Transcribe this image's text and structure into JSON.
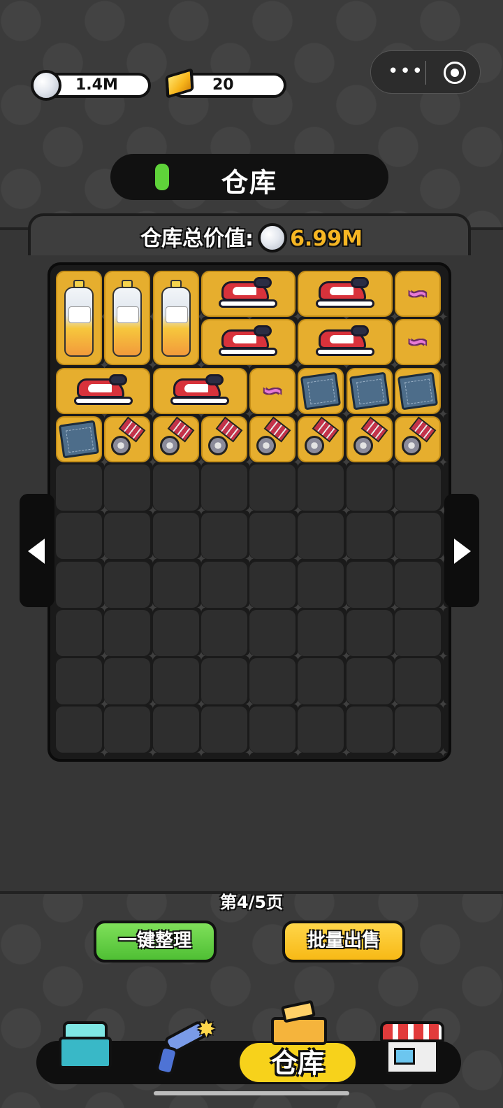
{
  "currency": {
    "silver": "1.4M",
    "gold": "20"
  },
  "capsule": {
    "more_icon": "more-dots-icon",
    "close_icon": "target-icon"
  },
  "header": {
    "title": "仓库"
  },
  "warehouse": {
    "total_label": "仓库总价值:",
    "total_value": "6.99M",
    "grid": {
      "columns": 8,
      "rows": 10,
      "items": [
        {
          "type": "bottle",
          "icon": "bottle-icon",
          "col": 0,
          "row": 0,
          "w": 1,
          "h": 2
        },
        {
          "type": "bottle",
          "icon": "bottle-icon",
          "col": 1,
          "row": 0,
          "w": 1,
          "h": 2
        },
        {
          "type": "bottle",
          "icon": "bottle-icon",
          "col": 2,
          "row": 0,
          "w": 1,
          "h": 2
        },
        {
          "type": "shoe",
          "icon": "sneaker-icon",
          "col": 3,
          "row": 0,
          "w": 2,
          "h": 1
        },
        {
          "type": "shoe",
          "icon": "sneaker-icon",
          "col": 5,
          "row": 0,
          "w": 2,
          "h": 1
        },
        {
          "type": "candy",
          "icon": "candy-icon",
          "col": 7,
          "row": 0,
          "w": 1,
          "h": 1
        },
        {
          "type": "shoe",
          "icon": "sneaker-icon",
          "col": 3,
          "row": 1,
          "w": 2,
          "h": 1
        },
        {
          "type": "shoe",
          "icon": "sneaker-icon",
          "col": 5,
          "row": 1,
          "w": 2,
          "h": 1
        },
        {
          "type": "candy",
          "icon": "candy-icon",
          "col": 7,
          "row": 1,
          "w": 1,
          "h": 1
        },
        {
          "type": "shoe",
          "icon": "sneaker-icon",
          "col": 0,
          "row": 2,
          "w": 2,
          "h": 1
        },
        {
          "type": "shoe",
          "icon": "sneaker-icon",
          "col": 2,
          "row": 2,
          "w": 2,
          "h": 1
        },
        {
          "type": "candy",
          "icon": "candy-icon",
          "col": 4,
          "row": 2,
          "w": 1,
          "h": 1
        },
        {
          "type": "book",
          "icon": "book-icon",
          "col": 5,
          "row": 2,
          "w": 1,
          "h": 1
        },
        {
          "type": "book",
          "icon": "book-icon",
          "col": 6,
          "row": 2,
          "w": 1,
          "h": 1
        },
        {
          "type": "book",
          "icon": "book-icon",
          "col": 7,
          "row": 2,
          "w": 1,
          "h": 1
        },
        {
          "type": "book",
          "icon": "book-icon",
          "col": 0,
          "row": 3,
          "w": 1,
          "h": 1
        },
        {
          "type": "medal",
          "icon": "medal-icon",
          "col": 1,
          "row": 3,
          "w": 1,
          "h": 1
        },
        {
          "type": "medal",
          "icon": "medal-icon",
          "col": 2,
          "row": 3,
          "w": 1,
          "h": 1
        },
        {
          "type": "medal",
          "icon": "medal-icon",
          "col": 3,
          "row": 3,
          "w": 1,
          "h": 1
        },
        {
          "type": "medal",
          "icon": "medal-icon",
          "col": 4,
          "row": 3,
          "w": 1,
          "h": 1
        },
        {
          "type": "medal",
          "icon": "medal-icon",
          "col": 5,
          "row": 3,
          "w": 1,
          "h": 1
        },
        {
          "type": "medal",
          "icon": "medal-icon",
          "col": 6,
          "row": 3,
          "w": 1,
          "h": 1
        },
        {
          "type": "medal",
          "icon": "medal-icon",
          "col": 7,
          "row": 3,
          "w": 1,
          "h": 1
        }
      ]
    }
  },
  "pager": {
    "label": "第4/5页",
    "prev_icon": "arrow-left-icon",
    "next_icon": "arrow-right-icon"
  },
  "actions": {
    "organize": "一键整理",
    "bulk_sell": "批量出售"
  },
  "nav": {
    "items": [
      {
        "icon": "toolbox-icon"
      },
      {
        "icon": "revolver-icon"
      },
      {
        "icon": "crate-icon",
        "label": "仓库",
        "active": true
      },
      {
        "icon": "shop-icon"
      }
    ]
  },
  "colors": {
    "item_bg": "#e6ae2e",
    "accent_gold": "#f6b623",
    "green": "#5fd33a"
  }
}
